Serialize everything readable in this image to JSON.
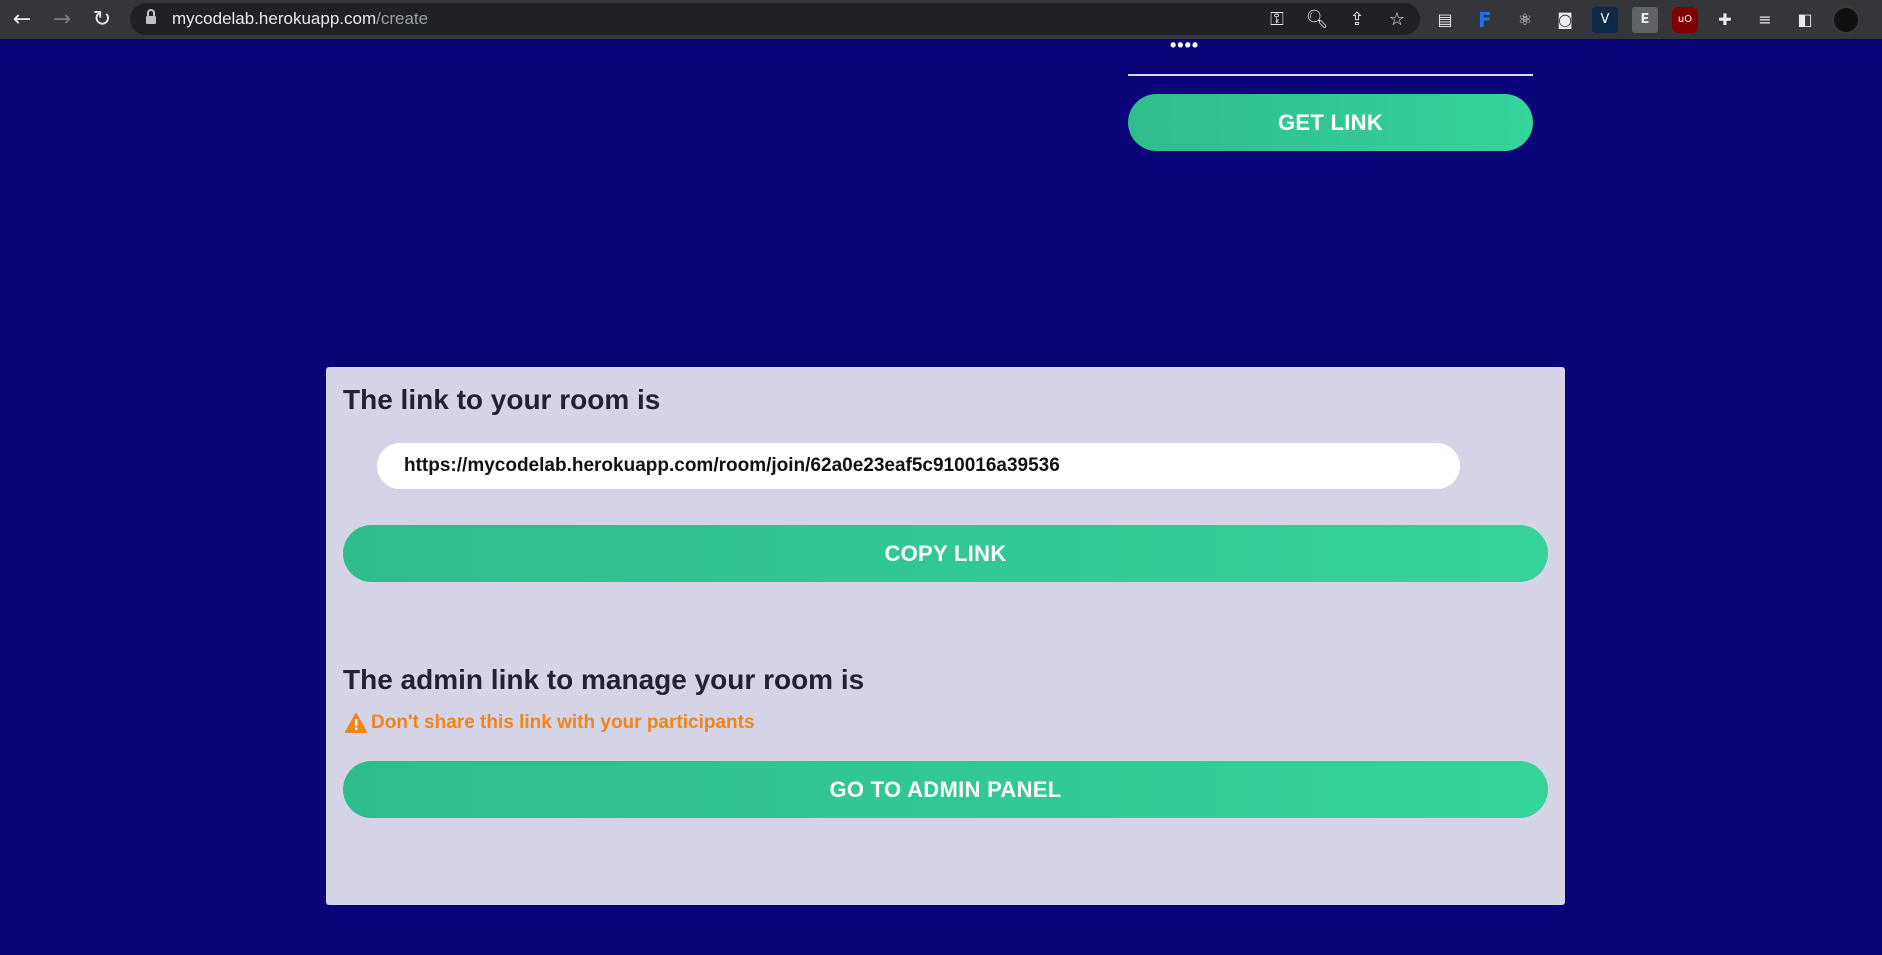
{
  "browser": {
    "url_host": "mycodelab.herokuapp.com",
    "url_path": "/create",
    "nav": {
      "back_icon": "←",
      "forward_icon": "→",
      "reload_icon": "↻"
    },
    "omnibox_icons": [
      "key-icon",
      "zoom-icon",
      "share-icon",
      "star-icon"
    ],
    "extensions": [
      "F",
      "V",
      "E",
      "uO"
    ]
  },
  "form": {
    "password_mask": "••••",
    "get_link_label": "GET LINK"
  },
  "room_card": {
    "title": "The link to your room is",
    "room_link": "https://mycodelab.herokuapp.com/room/join/62a0e23eaf5c910016a39536",
    "copy_label": "COPY LINK",
    "admin_title": "The admin link to manage your room is",
    "warning_text": "Don't share this link with your participants",
    "admin_button_label": "GO TO ADMIN PANEL"
  },
  "colors": {
    "background": "#0b0378",
    "accent": "#34d49a",
    "warning": "#f2841d",
    "card": "#d5d4e6"
  }
}
